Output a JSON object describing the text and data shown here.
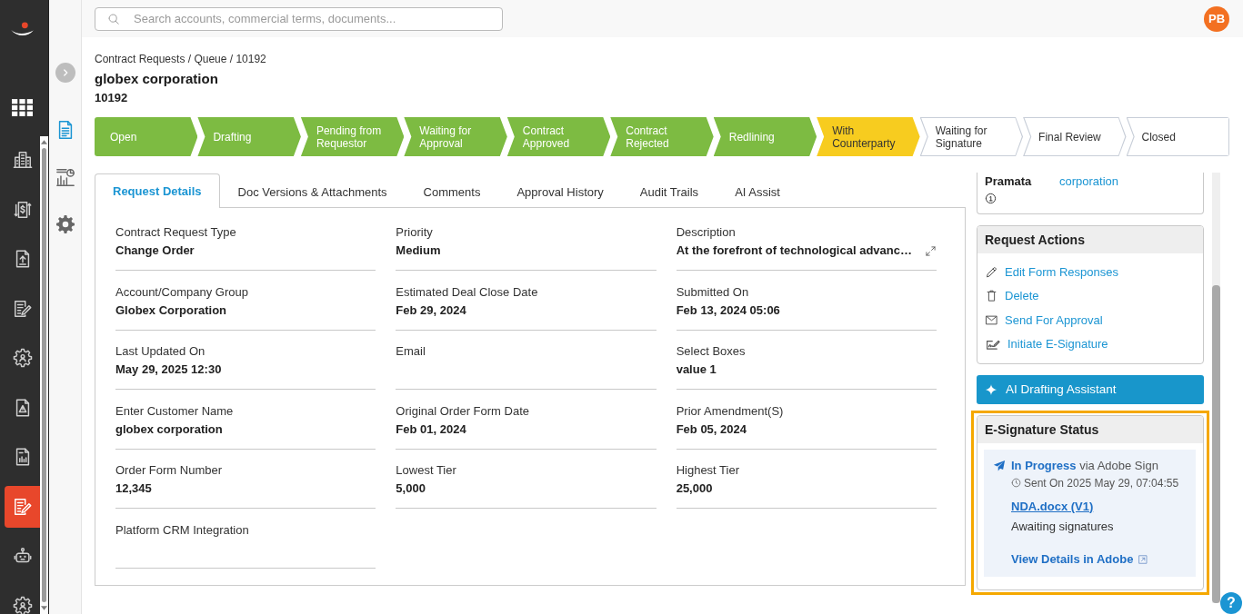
{
  "nav_rail": {
    "items": [
      {
        "selected": false
      },
      {
        "selected": false
      },
      {
        "selected": false
      },
      {
        "selected": false
      },
      {
        "selected": false
      },
      {
        "selected": false
      },
      {
        "selected": false
      },
      {
        "selected": false
      },
      {
        "selected": true
      },
      {
        "selected": false
      },
      {
        "selected": false
      }
    ]
  },
  "secondary_rail": {
    "items": [
      {
        "selected": true
      },
      {
        "selected": false
      },
      {
        "selected": false
      }
    ]
  },
  "search": {
    "placeholder": "Search accounts, commercial terms, documents..."
  },
  "user": {
    "initials": "PB"
  },
  "breadcrumb": "Contract Requests / Queue / 10192",
  "title": "globex corporation",
  "request_id": "10192",
  "stages": [
    {
      "label": "Open",
      "done": true,
      "current": false
    },
    {
      "label": "Drafting",
      "done": true,
      "current": false
    },
    {
      "label": "Pending from Requestor",
      "done": true,
      "current": false
    },
    {
      "label": "Waiting for Approval",
      "done": true,
      "current": false
    },
    {
      "label": "Contract Approved",
      "done": true,
      "current": false
    },
    {
      "label": "Contract Rejected",
      "done": true,
      "current": false
    },
    {
      "label": "Redlining",
      "done": true,
      "current": false
    },
    {
      "label": "With Counterparty",
      "done": false,
      "current": true
    },
    {
      "label": "Waiting for Signature",
      "done": false,
      "current": false
    },
    {
      "label": "Final Review",
      "done": false,
      "current": false
    },
    {
      "label": "Closed",
      "done": false,
      "current": false
    }
  ],
  "tabs": [
    {
      "label": "Request Details",
      "selected": true
    },
    {
      "label": "Doc Versions & Attachments",
      "selected": false
    },
    {
      "label": "Comments",
      "selected": false
    },
    {
      "label": "Approval History",
      "selected": false
    },
    {
      "label": "Audit Trails",
      "selected": false
    },
    {
      "label": "AI Assist",
      "selected": false
    }
  ],
  "fields": [
    {
      "label": "Contract Request Type",
      "value": "Change Order",
      "expandable": false
    },
    {
      "label": "Priority",
      "value": "Medium",
      "expandable": false
    },
    {
      "label": "Description",
      "value": "At the forefront of technological advanc…",
      "expandable": true
    },
    {
      "label": "Account/Company Group",
      "value": "Globex Corporation",
      "expandable": false
    },
    {
      "label": "Estimated Deal Close Date",
      "value": "Feb 29, 2024",
      "expandable": false
    },
    {
      "label": "Submitted On",
      "value": "Feb 13, 2024 05:06",
      "expandable": false
    },
    {
      "label": "Last Updated On",
      "value": "May 29, 2025 12:30",
      "expandable": false
    },
    {
      "label": "Email",
      "expandable": false
    },
    {
      "label": "Select Boxes",
      "value": "value 1",
      "expandable": false
    },
    {
      "label": "Enter Customer Name",
      "value": "globex corporation",
      "expandable": false
    },
    {
      "label": "Original Order Form Date",
      "value": "Feb 01, 2024",
      "expandable": false
    },
    {
      "label": "Prior Amendment(S)",
      "value": "Feb 05, 2024",
      "expandable": false
    },
    {
      "label": "Order Form Number",
      "value": "12,345",
      "expandable": false
    },
    {
      "label": "Lowest Tier",
      "value": "5,000",
      "expandable": false
    },
    {
      "label": "Highest Tier",
      "value": "25,000",
      "expandable": false
    },
    {
      "label": "Platform CRM Integration",
      "expandable": false
    }
  ],
  "account_card": {
    "label": "Pramata",
    "value": "corporation"
  },
  "request_actions": {
    "title": "Request Actions",
    "items": [
      {
        "label": "Edit Form Responses"
      },
      {
        "label": "Delete"
      },
      {
        "label": "Send For Approval"
      },
      {
        "label": "Initiate E-Signature"
      }
    ]
  },
  "ai_button": {
    "label": "AI Drafting Assistant"
  },
  "esignature": {
    "title": "E-Signature Status",
    "highlighted": true,
    "status": "**In Progress** via Adobe Sign",
    "sent_on": "Sent On 2025 May 29, 07:04:55",
    "document": "NDA.docx (V1)",
    "note": "Awaiting signatures",
    "details_link": "View Details in Adobe"
  },
  "help": {
    "label": "?"
  }
}
